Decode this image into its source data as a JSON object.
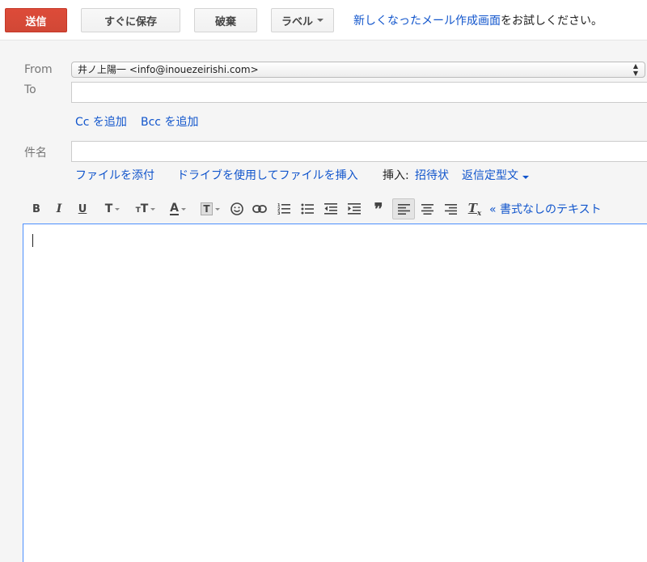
{
  "toolbar": {
    "send_label": "送信",
    "save_now_label": "すぐに保存",
    "discard_label": "破棄",
    "label_label": "ラベル",
    "try_new_link": "新しくなったメール作成画面",
    "try_new_suffix": "をお試しください。"
  },
  "compose": {
    "from_label": "From",
    "from_value": "井ノ上陽一 <info@inouezeirishi.com>",
    "to_label": "To",
    "to_value": "",
    "cc_link": "Cc を追加",
    "bcc_link": "Bcc を追加",
    "subject_label": "件名",
    "subject_value": "",
    "attach_link": "ファイルを添付",
    "drive_link": "ドライブを使用してファイルを挿入",
    "insert_label": "挿入:",
    "invitation_link": "招待状",
    "canned_link": "返信定型文"
  },
  "format": {
    "plain_text_link": "« 書式なしのテキスト",
    "tools": [
      {
        "name": "bold-icon",
        "glyph": "B"
      },
      {
        "name": "italic-icon",
        "glyph": "I"
      },
      {
        "name": "underline-icon",
        "glyph": "U"
      },
      {
        "name": "font-icon",
        "glyph": "T"
      },
      {
        "name": "font-size-icon",
        "glyph": "тT"
      },
      {
        "name": "text-color-icon",
        "glyph": "A"
      },
      {
        "name": "highlight-color-icon",
        "glyph": "T"
      },
      {
        "name": "emoji-icon",
        "glyph": "☺"
      },
      {
        "name": "link-icon",
        "glyph": "⊂⊃"
      },
      {
        "name": "numbered-list-icon",
        "glyph": "≡"
      },
      {
        "name": "bulleted-list-icon",
        "glyph": "≡"
      },
      {
        "name": "indent-less-icon",
        "glyph": "⇤"
      },
      {
        "name": "indent-more-icon",
        "glyph": "⇥"
      },
      {
        "name": "quote-icon",
        "glyph": "❞"
      },
      {
        "name": "align-left-icon",
        "glyph": "≡"
      },
      {
        "name": "align-center-icon",
        "glyph": "≡"
      },
      {
        "name": "align-right-icon",
        "glyph": "≡"
      },
      {
        "name": "remove-formatting-icon",
        "glyph": "Tx"
      }
    ]
  },
  "body": {
    "text": ""
  }
}
